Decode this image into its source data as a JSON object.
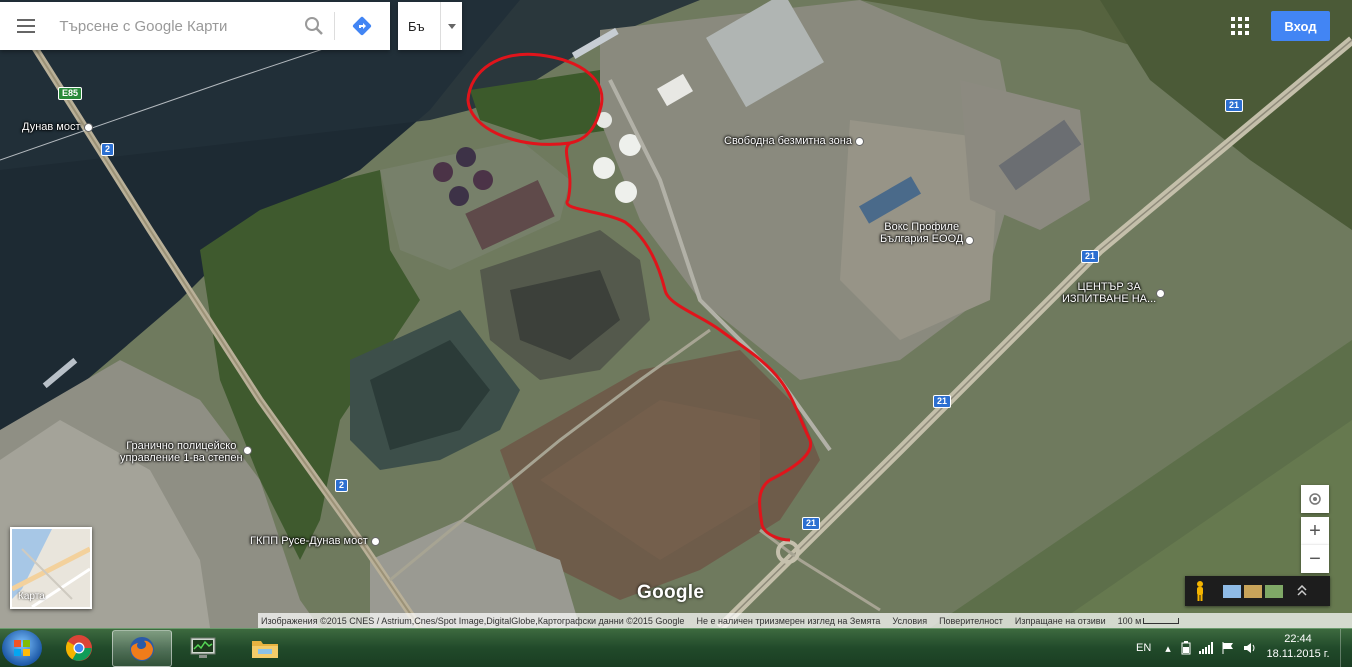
{
  "search": {
    "placeholder": "Търсене с Google Карти",
    "menu_icon": "hamburger-menu-icon",
    "search_icon": "magnifier-icon",
    "directions_icon": "directions-diamond-icon"
  },
  "language": {
    "label": "Бъ"
  },
  "header": {
    "signin_label": "Вход",
    "apps_icon": "apps-grid-icon"
  },
  "map_labels": {
    "bridge": "Дунав мост",
    "free_zone": "Свободна безмитна зона",
    "vox_line1": "Вокс Профиле",
    "vox_line2": "България ЕООД",
    "center_line1": "ЦЕНТЪР ЗА",
    "center_line2": "ИЗПИТВАНЕ НА...",
    "border_police_line1": "Гранично полицейско",
    "border_police_line2": "управление 1-ва степен",
    "checkpoint": "ГКПП Русе-Дунав мост"
  },
  "road_shields": {
    "e85": "E85",
    "r2_a": "2",
    "r2_b": "2",
    "r21_a": "21",
    "r21_b": "21",
    "r21_c": "21",
    "r21_d": "21"
  },
  "thumbnail": {
    "label": "Карта"
  },
  "controls": {
    "location_icon": "my-location-icon",
    "zoom_in": "+",
    "zoom_out": "−",
    "pegman_icon": "pegman-icon",
    "expand_icon": "chevron-up-double-icon"
  },
  "google_logo": "Google",
  "footer": {
    "imagery": "Изображения ©2015 CNES / Astrium,Cnes/Spot Image,DigitalGlobe,Картографски данни ©2015 Google",
    "no_3d": "Не е наличен триизмерен изглед на Земята",
    "terms": "Условия",
    "privacy": "Поверителност",
    "feedback": "Изпращане на отзиви",
    "scale": "100 м"
  },
  "taskbar": {
    "language": "EN",
    "time": "22:44",
    "date": "18.11.2015 г.",
    "apps": [
      "chrome-icon",
      "firefox-icon",
      "system-monitor-icon",
      "file-explorer-icon"
    ]
  },
  "colors": {
    "route": "#e0141b",
    "signin": "#4285f4",
    "road_shield": "#2c6fd1"
  }
}
